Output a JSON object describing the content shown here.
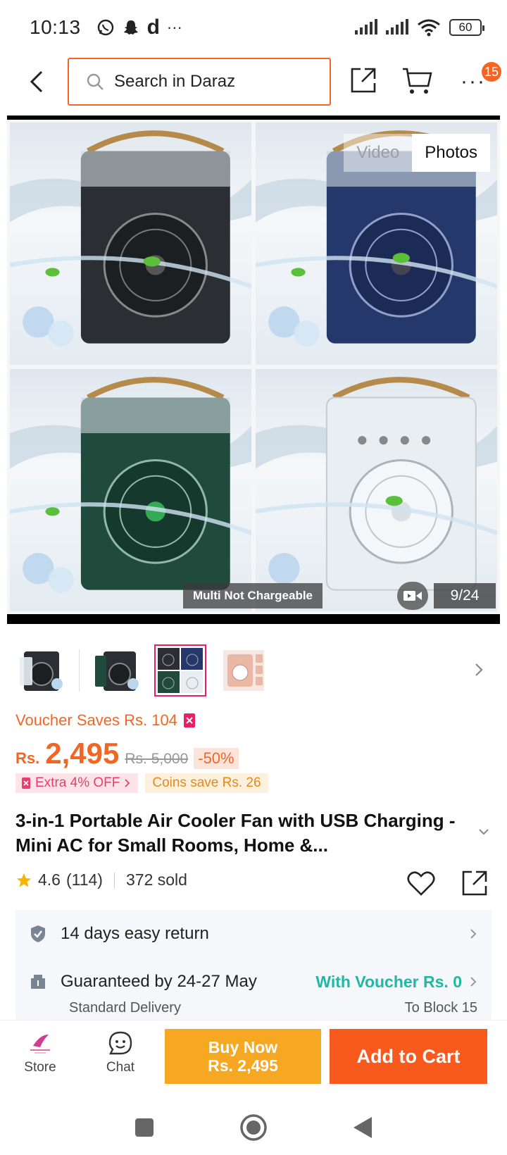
{
  "status_bar": {
    "time": "10:13",
    "carrier_letter": "d",
    "overflow": "···",
    "battery": "60"
  },
  "header": {
    "search_placeholder": "Search in Daraz",
    "notification_count": "15",
    "more_label": "···"
  },
  "gallery": {
    "tab_video": "Video",
    "tab_photos": "Photos",
    "active_tab": "Photos",
    "caption": "Multi Not Chargeable",
    "counter": "9/24",
    "fan_colors": [
      "#2b2f33",
      "#24386b",
      "#1f4a3c",
      "#e9eef2"
    ]
  },
  "thumbnails": {
    "selected_index": 2
  },
  "price": {
    "voucher_text": "Voucher Saves Rs. 104",
    "currency": "Rs.",
    "current": "2,495",
    "original": "Rs. 5,000",
    "discount": "-50%",
    "extra_off": "Extra 4% OFF",
    "coins": "Coins save Rs. 26"
  },
  "product": {
    "title": "3-in-1 Portable Air Cooler Fan with USB Charging - Mini AC for Small Rooms, Home &...",
    "rating": "4.6",
    "reviews": "(114)",
    "sold": "372 sold"
  },
  "info": {
    "return_text": "14 days easy return",
    "delivery_text": "Guaranteed by 24-27 May",
    "delivery_voucher": "With Voucher Rs. 0",
    "delivery_type": "Standard Delivery",
    "delivery_to": "To Block 15"
  },
  "actions": {
    "store": "Store",
    "chat": "Chat",
    "buy_now": "Buy Now",
    "buy_price": "Rs. 2,495",
    "add_to_cart": "Add to Cart"
  },
  "colors": {
    "accent": "#f26522",
    "buy_now": "#f7a823",
    "add_to_cart": "#f8591d",
    "voucher_green": "#1fb7a6"
  }
}
